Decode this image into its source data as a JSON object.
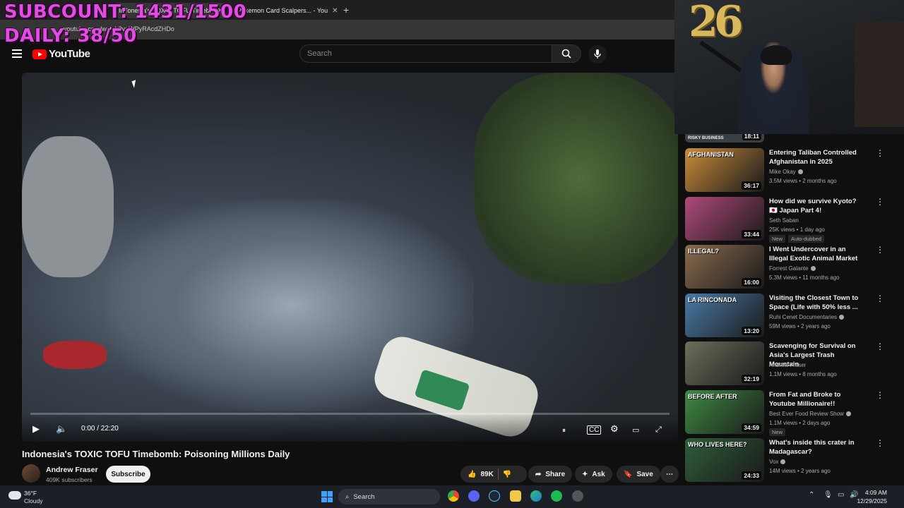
{
  "browser": {
    "tabs": [
      {
        "label": "Indonesia's TOXIC TOFU Timebo",
        "active": true
      },
      {
        "label": "Pokemon Card Scalpers... - You",
        "active": false
      }
    ],
    "url": "youtube.com/watch?v=WPyRAcdZHDo"
  },
  "overlay": {
    "subcount": "SUBCOUNT: 1431/1500",
    "daily": "DAILY: 38/50"
  },
  "masthead": {
    "logo_text": "YouTube",
    "search_placeholder": "Search"
  },
  "player": {
    "timecode": "0:00 / 22:20",
    "progress": 0
  },
  "video": {
    "title": "Indonesia's TOXIC TOFU Timebomb: Poisoning Millions Daily",
    "channel": "Andrew Fraser",
    "subscribers": "409K subscribers",
    "subscribe_label": "Subscribe",
    "likes": "89K",
    "share_label": "Share",
    "ask_label": "Ask",
    "save_label": "Save"
  },
  "webcam": {
    "balloon_text": "26"
  },
  "recommendations": {
    "partial_top": {
      "duration": "18:11",
      "badge": "RISKY BUSINESS"
    },
    "items": [
      {
        "title": "Entering Taliban Controlled Afghanistan in 2025",
        "channel": "Mike Okay",
        "verified": true,
        "meta": "3.5M views • 2 months ago",
        "duration": "36:17",
        "thumb_text": "AFGHANISTAN",
        "thumb_color": "#c98b3c",
        "badges": []
      },
      {
        "title": "How did we survive Kyoto? 🇯🇵 Japan Part 4!",
        "channel": "Seth Saban",
        "verified": false,
        "meta": "25K views • 1 day ago",
        "duration": "33:44",
        "thumb_text": "",
        "thumb_color": "#b04a7a",
        "badges": [
          "New",
          "Auto-dubbed"
        ]
      },
      {
        "title": "I Went Undercover in an Illegal Exotic Animal Market",
        "channel": "Forrest Galante",
        "verified": true,
        "meta": "5.3M views • 11 months ago",
        "duration": "16:00",
        "thumb_text": "ILLEGAL?",
        "thumb_color": "#8a6b4e",
        "badges": []
      },
      {
        "title": "Visiting the Closest Town to Space (Life with 50% less ...",
        "channel": "Ruhi Cenet Documentaries",
        "verified": true,
        "meta": "59M views • 2 years ago",
        "duration": "13:20",
        "thumb_text": "LA RINCONADA",
        "thumb_color": "#4a7aa8",
        "badges": []
      },
      {
        "title": "Scavenging for Survival on Asia's Largest Trash Mountain",
        "channel": "Andrew Fraser",
        "verified": false,
        "meta": "1.1M views • 8 months ago",
        "duration": "32:19",
        "thumb_text": "",
        "thumb_color": "#6b6f5a",
        "badges": []
      },
      {
        "title": "From Fat and Broke to Youtube Millionaire!!",
        "channel": "Best Ever Food Review Show",
        "verified": true,
        "meta": "1.1M views • 2 days ago",
        "duration": "34:59",
        "thumb_text": "BEFORE   AFTER",
        "thumb_color": "#3f8a44",
        "badges": [
          "New"
        ]
      },
      {
        "title": "What's inside this crater in Madagascar?",
        "channel": "Vox",
        "verified": true,
        "meta": "14M views • 2 years ago",
        "duration": "24:33",
        "thumb_text": "WHO LIVES HERE?",
        "thumb_color": "#2f5d3a",
        "badges": []
      }
    ]
  },
  "taskbar": {
    "temperature": "36°F",
    "condition": "Cloudy",
    "search_label": "Search",
    "time": "4:09 AM",
    "date": "12/29/2025"
  },
  "colors": {
    "overlay": "#e64ae6",
    "youtube_red": "#ff0000",
    "background": "#0f0f0f"
  }
}
